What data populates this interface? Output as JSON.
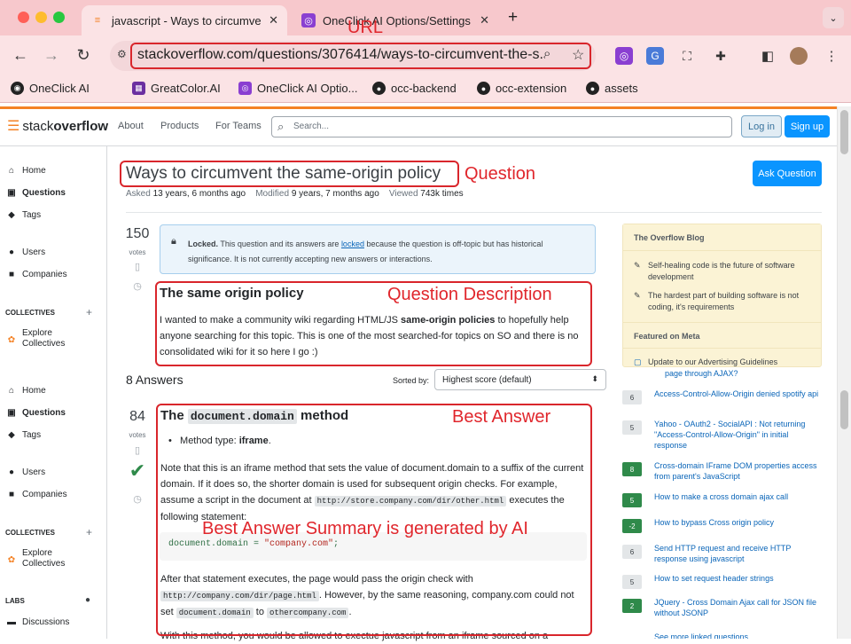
{
  "browser": {
    "tabs": [
      {
        "title": "javascript - Ways to circumve",
        "close": "✕"
      },
      {
        "title": "OneClick AI Options/Settings",
        "close": "✕"
      }
    ],
    "new_tab": "+",
    "url": "stackoverflow.com/questions/3076414/ways-to-circumvent-the-s...",
    "bookmarks": [
      "OneClick AI",
      "GreatColor.AI",
      "OneClick AI Optio...",
      "occ-backend",
      "occ-extension",
      "assets"
    ]
  },
  "annotations": {
    "url": "URL",
    "question": "Question",
    "question_description": "Question Description",
    "best_answer": "Best Answer",
    "summary": "Best Answer Summary is generated by AI"
  },
  "header": {
    "logo_plain": "stack",
    "logo_bold": "overflow",
    "nav": [
      "About",
      "Products",
      "For Teams"
    ],
    "search_placeholder": "Search...",
    "login": "Log in",
    "signup": "Sign up"
  },
  "sidebar": {
    "top": [
      "Home",
      "Questions",
      "Tags",
      "Users",
      "Companies"
    ],
    "collectives_heading": "COLLECTIVES",
    "explore_collectives": [
      "Explore",
      "Collectives"
    ],
    "repeat": [
      "Home",
      "Questions",
      "Tags",
      "Users",
      "Companies"
    ],
    "labs_heading": "LABS",
    "discussions": "Discussions"
  },
  "question": {
    "title": "Ways to circumvent the same-origin policy",
    "ask_button": "Ask Question",
    "asked_label": "Asked",
    "asked": "13 years, 6 months ago",
    "modified_label": "Modified",
    "modified": "9 years, 7 months ago",
    "viewed_label": "Viewed",
    "viewed": "743k times",
    "votes": "150",
    "votes_label": "votes",
    "locked_bold": "Locked.",
    "locked_text1": " This question and its answers are ",
    "locked_link": "locked",
    "locked_text2": " because the question is off-topic but has historical significance. It is not currently accepting new answers or interactions.",
    "heading": "The same origin policy",
    "body_1": "I wanted to make a community wiki regarding HTML/JS ",
    "body_bold": "same-origin policies",
    "body_2": " to hopefully help anyone searching for this topic. This is one of the most searched-for topics on SO and there is no consolidated wiki for it so here I go :)"
  },
  "answers": {
    "count_label": "8 Answers",
    "sorted_by": "Sorted by:",
    "sort_value": "Highest score (default)",
    "votes": "84",
    "votes_label": "votes",
    "heading_pre": "The ",
    "heading_code": "document.domain",
    "heading_post": " method",
    "bullet_pre": "Method type: ",
    "bullet_bold": "iframe",
    "bullet_post": ".",
    "p1": "Note that this is an iframe method that sets the value of document.domain to a suffix of the current domain. If it does so, the shorter domain is used for subsequent origin checks. For example, assume a script in the document at ",
    "p1_code": "http://store.company.com/dir/other.html",
    "p1_end": " executes the following statement:",
    "code_a": "document.domain = ",
    "code_b": "\"company.com\"",
    "code_c": ";",
    "p2_a": "After that statement executes, the page would pass the origin check with ",
    "p2_code1": "http://company.com/dir/page.html",
    "p2_b": ". However, by the same reasoning, company.com could not set ",
    "p2_code2": "document.domain",
    "p2_c": " to ",
    "p2_code3": "othercompany.com",
    "p2_d": ".",
    "p3": "With this method, you would be allowed to exectue javascript from an iframe sourced on a"
  },
  "blog": {
    "heading": "The Overflow Blog",
    "items": [
      "Self-healing code is the future of software development",
      "The hardest part of building software is not coding, it's requirements"
    ],
    "meta_heading": "Featured on Meta",
    "meta_item": "Update to our Advertising Guidelines"
  },
  "linked": [
    {
      "count": "",
      "title": "page through AJAX?"
    },
    {
      "count": "6",
      "title": "Access-Control-Allow-Origin denied spotify api"
    },
    {
      "count": "5",
      "title": "Yahoo - OAuth2 - SocialAPI : Not returning \"Access-Control-Allow-Origin\" in initial response"
    },
    {
      "count": "8",
      "title": "Cross-domain IFrame DOM properties access from parent's JavaScript"
    },
    {
      "count": "5",
      "title": "How to make a cross domain ajax call"
    },
    {
      "count": "-2",
      "title": "How to bypass Cross origin policy"
    },
    {
      "count": "6",
      "title": "Send HTTP request and receive HTTP response using javascript"
    },
    {
      "count": "5",
      "title": "How to set request header strings"
    },
    {
      "count": "2",
      "title": "JQuery - Cross Domain Ajax call for JSON file without JSONP"
    },
    {
      "count": "",
      "title": "See more linked questions"
    }
  ],
  "colors": {
    "accent": "#0a95ff",
    "red": "#d9262c",
    "green": "#2f8a4a",
    "so_orange": "#f48225"
  }
}
